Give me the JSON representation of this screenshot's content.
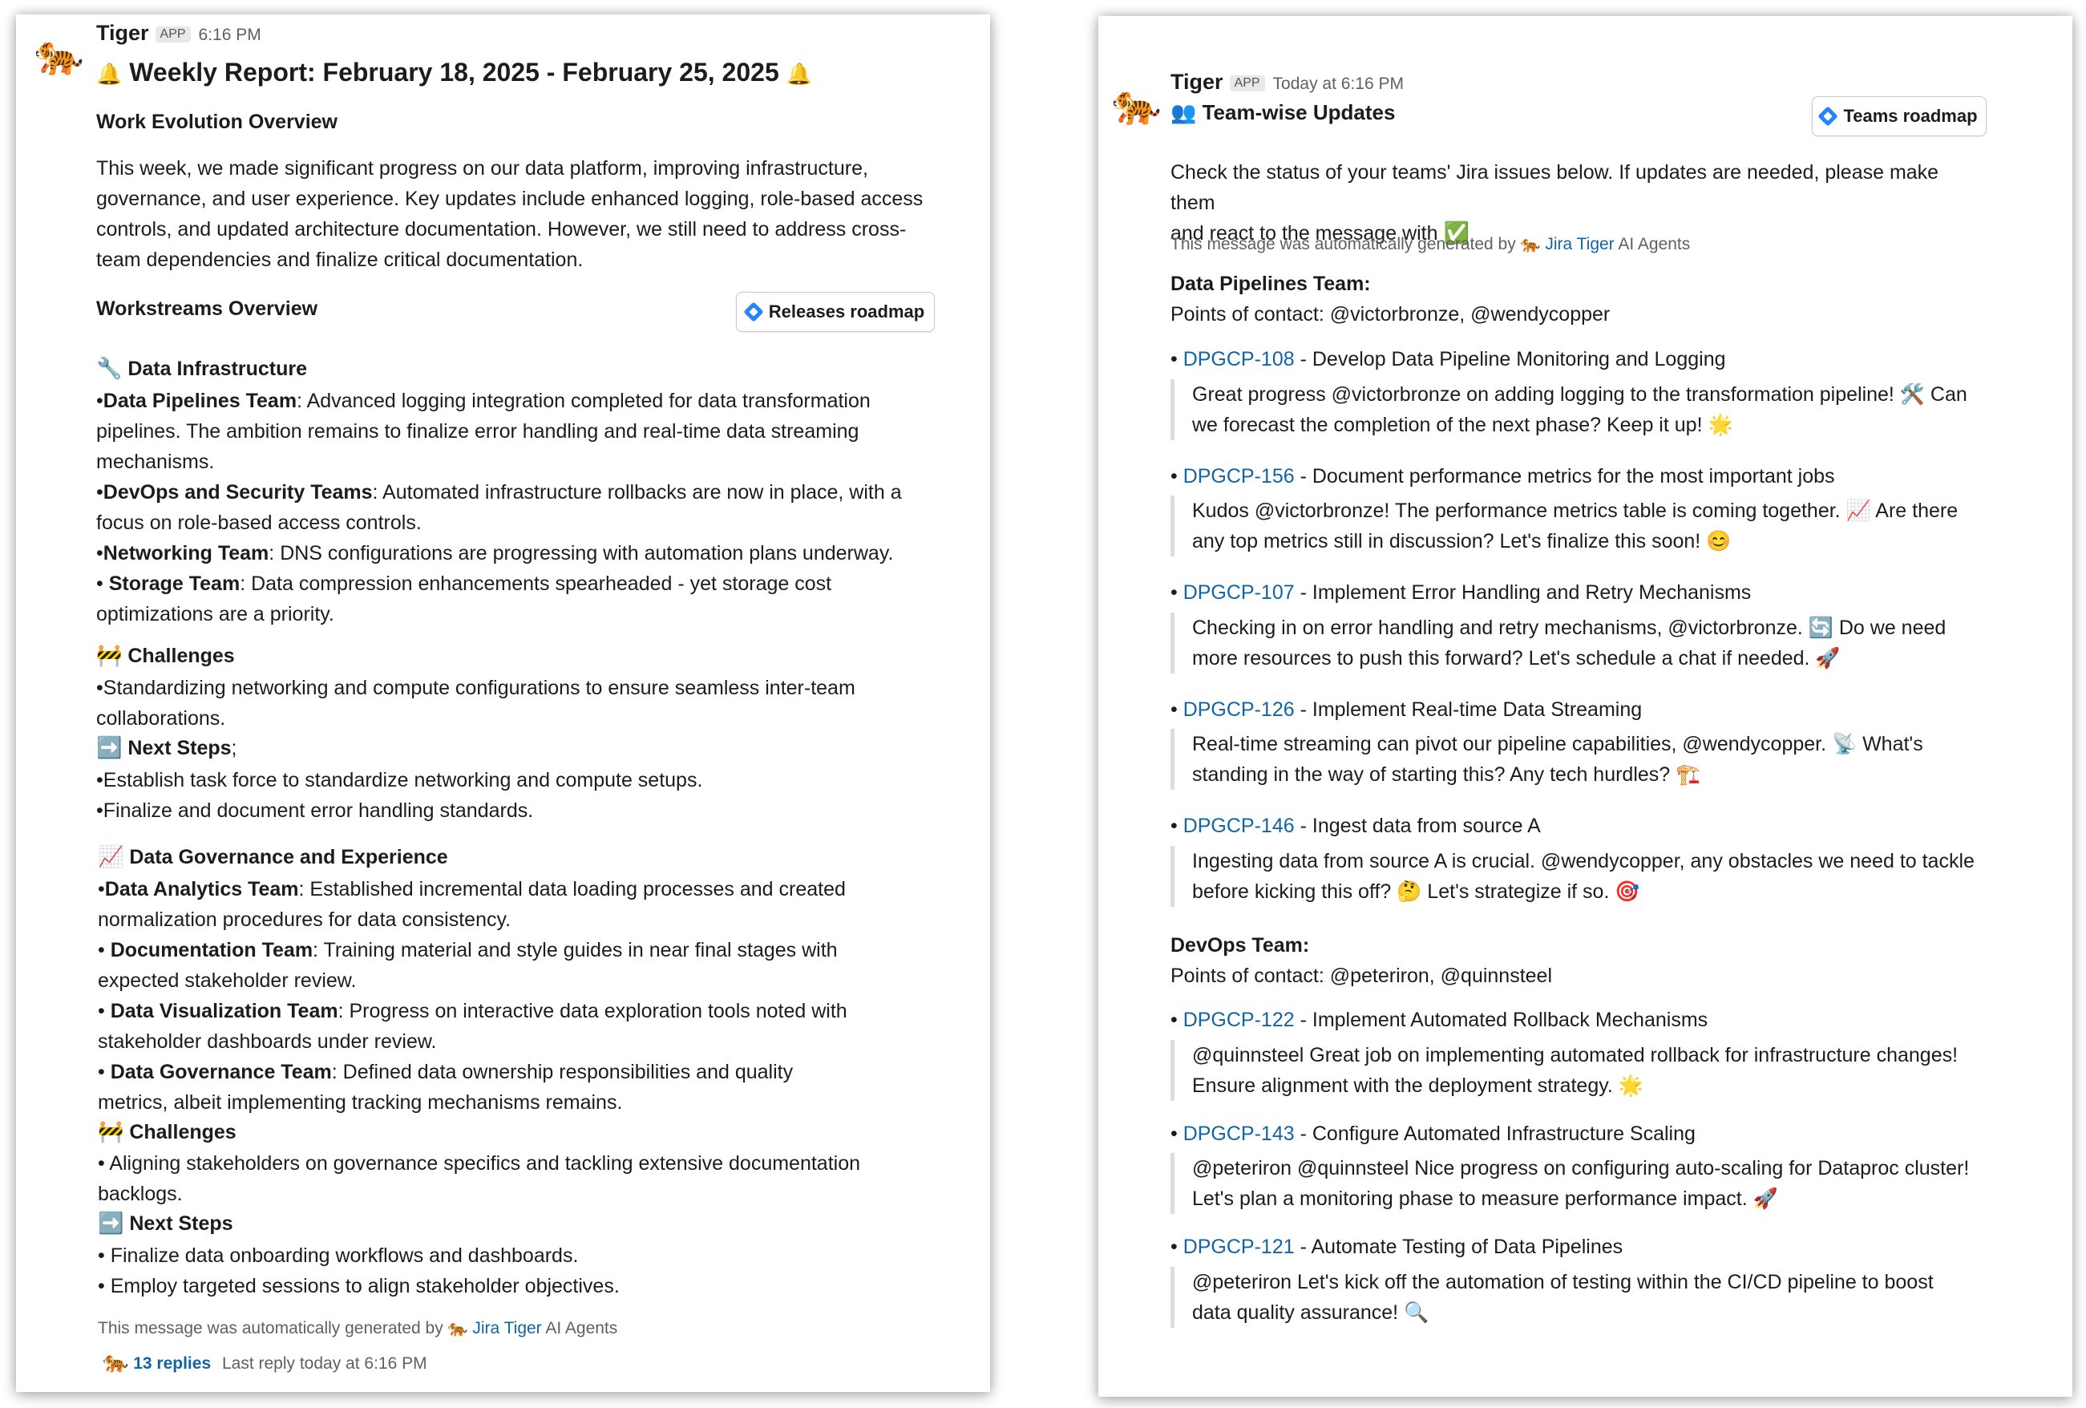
{
  "left_message": {
    "bot_name": "Tiger",
    "app_badge": "APP",
    "time": "6:16 PM",
    "title": "Weekly Report: February 18, 2025 - February 25, 2025",
    "work_evolution_heading": "Work Evolution Overview",
    "work_evolution_body": "This week, we made significant progress on our data platform, improving infrastructure, governance, and user experience. Key updates include enhanced logging, role-based access controls, and updated architecture documentation. However, we still need to address cross-team dependencies and finalize critical documentation.",
    "workstreams_heading": "Workstreams Overview",
    "releases_button": "Releases roadmap",
    "infra": {
      "heading": "Data Infrastructure",
      "items": [
        {
          "team": "Data Pipelines Team",
          "text": ": Advanced logging integration completed for data transformation pipelines. The ambition remains to finalize error handling and real-time data streaming mechanisms."
        },
        {
          "team": "DevOps and Security Teams",
          "text": ": Automated infrastructure rollbacks are now in place, with a focus on role-based access controls."
        },
        {
          "team": "Networking Team",
          "text": ": DNS configurations are progressing with automation plans underway."
        },
        {
          "team": "Storage Team",
          "text": ": Data compression enhancements spearheaded - yet storage cost optimizations are a priority."
        }
      ],
      "challenges_heading": "Challenges",
      "challenges": [
        "Standardizing networking and compute configurations to ensure seamless inter-team collaborations."
      ],
      "next_steps_heading": "Next Steps",
      "next_steps_suffix": ";",
      "next_steps": [
        "Establish task force to standardize networking and compute setups.",
        "Finalize and document error handling standards."
      ]
    },
    "governance": {
      "heading": "Data Governance and Experience",
      "items": [
        {
          "team": "Data Analytics Team",
          "text": ": Established incremental data loading processes and created normalization procedures for data consistency."
        },
        {
          "team": "Documentation Team",
          "text": ": Training material and style guides in near final stages with expected stakeholder review."
        },
        {
          "team": "Data Visualization Team",
          "text": ": Progress on interactive data exploration tools noted with stakeholder dashboards under review."
        },
        {
          "team": "Data Governance Team",
          "text": ": Defined data ownership responsibilities and quality metrics, albeit implementing tracking mechanisms remains."
        }
      ],
      "challenges_heading": "Challenges",
      "challenges": [
        "Aligning stakeholders on governance specifics and tackling extensive documentation backlogs."
      ],
      "next_steps_heading": "Next Steps",
      "next_steps": [
        "Finalize data onboarding workflows and dashboards.",
        "Employ targeted sessions to align stakeholder objectives."
      ]
    },
    "footer_prefix": "This message was automatically generated by",
    "footer_link": "Jira Tiger",
    "footer_suffix": "AI Agents",
    "replies": "13 replies",
    "last_reply": "Last reply today at 6:16 PM"
  },
  "right_message": {
    "bot_name": "Tiger",
    "app_badge": "APP",
    "time": "Today at 6:16 PM",
    "title": "Team-wise Updates",
    "teams_button": "Teams roadmap",
    "intro_line1": "Check the status of your teams' Jira issues below. If updates are needed, please make them",
    "intro_line2": "and react to the message with",
    "footer_prefix": "This message was automatically generated by",
    "footer_link": "Jira Tiger",
    "footer_suffix": "AI Agents",
    "teams": [
      {
        "name": "Data Pipelines Team:",
        "contacts": "Points of contact: @victorbronze, @wendycopper",
        "issues": [
          {
            "key": "DPGCP-108",
            "title": " - Develop Data Pipeline Monitoring and Logging",
            "comment": [
              "Great progress @victorbronze on adding logging to the transformation pipeline! 🛠️ Can",
              "we forecast the completion of the next phase? Keep it up! 🌟"
            ]
          },
          {
            "key": "DPGCP-156",
            "title": " - Document performance metrics for the most important jobs",
            "comment": [
              "Kudos @victorbronze! The performance metrics table is coming together. 📈 Are there",
              "any top metrics still in discussion? Let's finalize this soon! 😊"
            ]
          },
          {
            "key": "DPGCP-107",
            "title": " - Implement Error Handling and Retry Mechanisms",
            "comment": [
              "Checking in on error handling and retry mechanisms, @victorbronze. 🔄 Do we need",
              "more resources to push this forward? Let's schedule a chat if needed. 🚀"
            ]
          },
          {
            "key": "DPGCP-126",
            "title": " - Implement Real-time Data Streaming",
            "comment": [
              "Real-time streaming can pivot our pipeline capabilities, @wendycopper. 📡 What's",
              "standing in the way of starting this? Any tech hurdles? 🏗️"
            ]
          },
          {
            "key": "DPGCP-146",
            "title": " - Ingest data from source A",
            "comment": [
              "Ingesting data from source A is crucial. @wendycopper, any obstacles we need to tackle",
              "before kicking this off? 🤔 Let's strategize if so. 🎯"
            ]
          }
        ]
      },
      {
        "name": "DevOps Team:",
        "contacts": "Points of contact: @peteriron, @quinnsteel",
        "issues": [
          {
            "key": "DPGCP-122",
            "title": " - Implement Automated Rollback Mechanisms",
            "comment": [
              "@quinnsteel Great job on implementing automated rollback for infrastructure changes!",
              "Ensure alignment with the deployment strategy. 🌟"
            ]
          },
          {
            "key": "DPGCP-143",
            "title": " - Configure Automated Infrastructure Scaling",
            "comment": [
              "@peteriron @quinnsteel Nice progress on configuring auto-scaling for Dataproc cluster!",
              "Let's plan a monitoring phase to measure performance impact. 🚀"
            ]
          },
          {
            "key": "DPGCP-121",
            "title": " - Automate Testing of Data Pipelines",
            "comment": [
              "@peteriron Let's kick off the automation of testing within the CI/CD pipeline to boost",
              "data quality assurance! 🔍"
            ]
          }
        ]
      }
    ]
  }
}
